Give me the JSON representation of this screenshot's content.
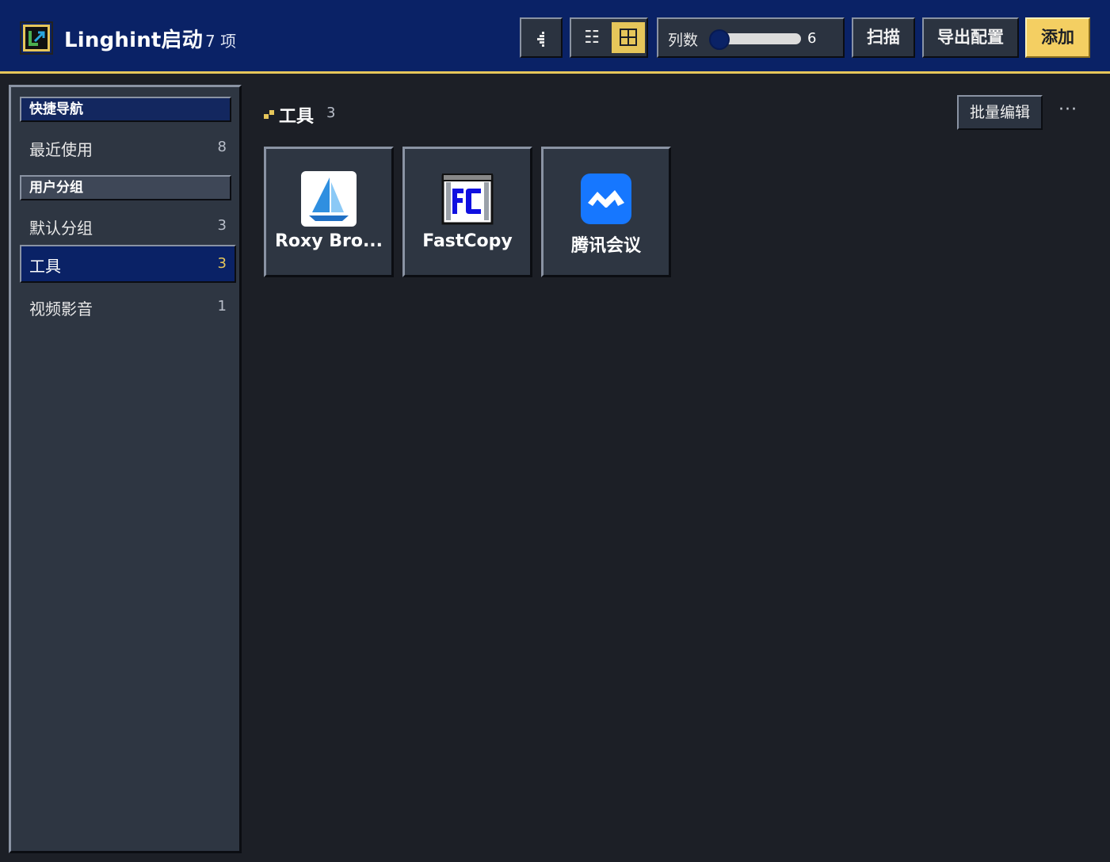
{
  "header": {
    "app_title": "Linghint启动",
    "item_count": "7 项",
    "view_list_glyph": "☷",
    "columns_label": "列数",
    "columns_value": "6",
    "columns_fraction": 0.0,
    "scan_label": "扫描",
    "export_label": "导出配置",
    "add_label": "添加",
    "accent_color": "#e6c65a",
    "header_color": "#0a2266"
  },
  "sidebar": {
    "quick_nav_title": "快捷导航",
    "quick_nav_items": [
      {
        "label": "最近使用",
        "count": "8"
      }
    ],
    "groups_title": "用户分组",
    "groups": [
      {
        "label": "默认分组",
        "count": "3"
      },
      {
        "label": "工具",
        "count": "3",
        "active": true
      },
      {
        "label": "视频影音",
        "count": "1"
      }
    ]
  },
  "main": {
    "group_title": "工具",
    "group_count": "3",
    "batch_edit_label": "批量编辑",
    "more_glyph": "···",
    "apps": [
      {
        "name": "Roxy Bro...",
        "icon": "sailboat-icon"
      },
      {
        "name": "FastCopy",
        "icon": "fastcopy-icon"
      },
      {
        "name": "腾讯会议",
        "icon": "tencent-meeting-icon"
      }
    ]
  }
}
